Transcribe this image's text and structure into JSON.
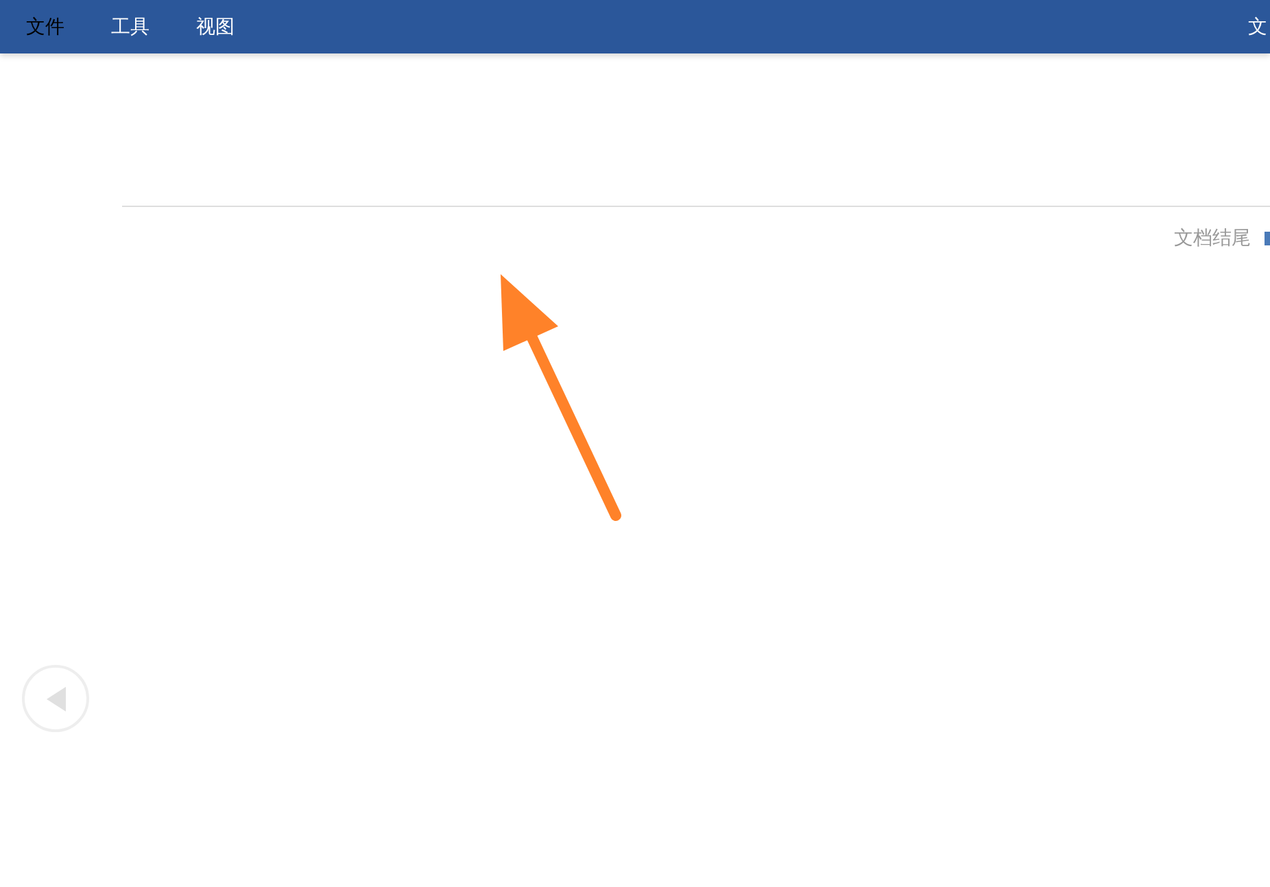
{
  "menu": [
    {
      "label": "文件",
      "selected": true
    },
    {
      "label": "工具",
      "selected": false
    },
    {
      "label": "视图",
      "selected": false
    }
  ],
  "menu_right": "文",
  "document": {
    "end_label": "文档结尾"
  }
}
